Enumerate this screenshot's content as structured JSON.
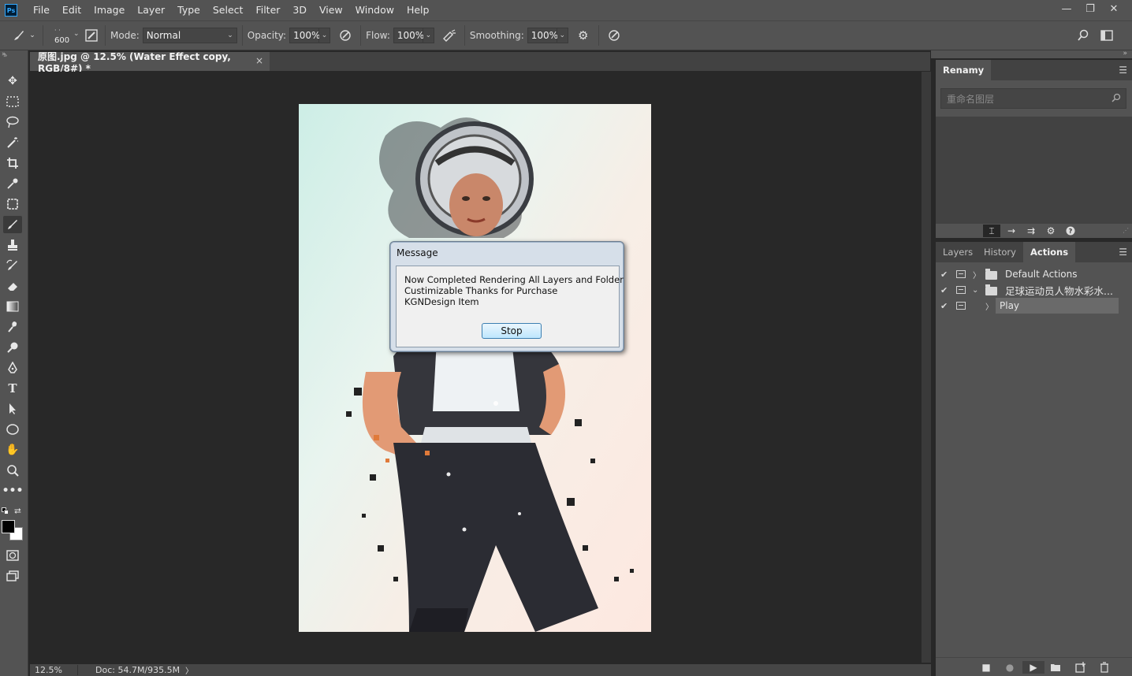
{
  "app": {
    "logo_text": "Ps"
  },
  "menu": [
    "File",
    "Edit",
    "Image",
    "Layer",
    "Type",
    "Select",
    "Filter",
    "3D",
    "View",
    "Window",
    "Help"
  ],
  "window_controls": {
    "minimize": "—",
    "restore": "❐",
    "close": "✕"
  },
  "options_bar": {
    "brush_size": "600",
    "mode_label": "Mode:",
    "mode_value": "Normal",
    "opacity_label": "Opacity:",
    "opacity_value": "100%",
    "flow_label": "Flow:",
    "flow_value": "100%",
    "smoothing_label": "Smoothing:",
    "smoothing_value": "100%"
  },
  "document": {
    "tab_title": "原图.jpg @ 12.5% (Water Effect copy, RGB/8#) *",
    "close": "×",
    "zoom": "12.5%",
    "doc_info": "Doc: 54.7M/935.5M",
    "status_arrow": "〉"
  },
  "dialog": {
    "title": "Message",
    "lines": [
      "Now Completed Rendering All Layers and Folder",
      "Custimizable Thanks for Purchase",
      "KGNDesign Item"
    ],
    "button": "Stop"
  },
  "renamy_panel": {
    "tab": "Renamy",
    "search_placeholder": "重命名图层"
  },
  "actions_panel": {
    "tabs": [
      "Layers",
      "History",
      "Actions"
    ],
    "active_tab": "Actions",
    "rows": [
      {
        "label": "Default Actions",
        "checked": "✔",
        "expanded": false
      },
      {
        "label": "足球运动员人物水彩水...",
        "checked": "✔",
        "expanded": true
      },
      {
        "label": "Play",
        "checked": "✔",
        "expanded": false
      }
    ]
  },
  "colors": {
    "ui_dark": "#535353",
    "ui_darker": "#424242",
    "workspace": "#282828",
    "dialog_bg": "#d6dfe9",
    "button_border": "#3c7fb1",
    "selected_row": "#6a6a6a"
  },
  "icons": {
    "tools": [
      "move-icon",
      "marquee-icon",
      "lasso-icon",
      "magic-wand-icon",
      "crop-icon",
      "eyedropper-icon",
      "frame-icon",
      "brush-icon",
      "stamp-icon",
      "history-brush-icon",
      "eraser-icon",
      "gradient-icon",
      "smudge-icon",
      "dodge-icon",
      "pen-icon",
      "type-icon",
      "path-select-icon",
      "ellipse-icon",
      "hand-icon",
      "zoom-icon",
      "more-tools-icon"
    ]
  }
}
